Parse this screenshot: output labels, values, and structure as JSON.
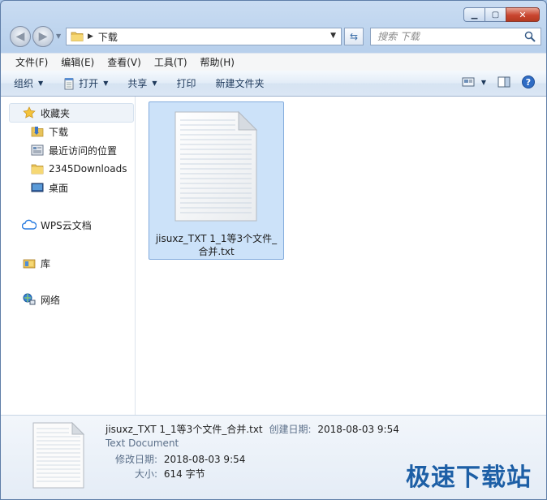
{
  "address": {
    "path": "下载"
  },
  "search": {
    "placeholder": "搜索 下载"
  },
  "menu": [
    "文件(F)",
    "编辑(E)",
    "查看(V)",
    "工具(T)",
    "帮助(H)"
  ],
  "toolbar": {
    "organize": "组织",
    "open": "打开",
    "share": "共享",
    "print": "打印",
    "new_folder": "新建文件夹"
  },
  "nav": {
    "favorites": "收藏夹",
    "downloads": "下载",
    "recent": "最近访问的位置",
    "downloads2345": "2345Downloads",
    "desktop": "桌面",
    "wps": "WPS云文档",
    "library": "库",
    "network": "网络"
  },
  "file": {
    "name": "jisuxz_TXT 1_1等3个文件_合并.txt"
  },
  "details": {
    "name": "jisuxz_TXT 1_1等3个文件_合并.txt",
    "created_label": "创建日期:",
    "created": "2018-08-03 9:54",
    "type": "Text Document",
    "modified_label": "修改日期:",
    "modified": "2018-08-03 9:54",
    "size_label": "大小:",
    "size": "614 字节"
  },
  "watermark": "极速下载站",
  "colors": {
    "selection": "#cce2f9",
    "selection_border": "#84acdd",
    "watermark": "#1d5fa6"
  }
}
